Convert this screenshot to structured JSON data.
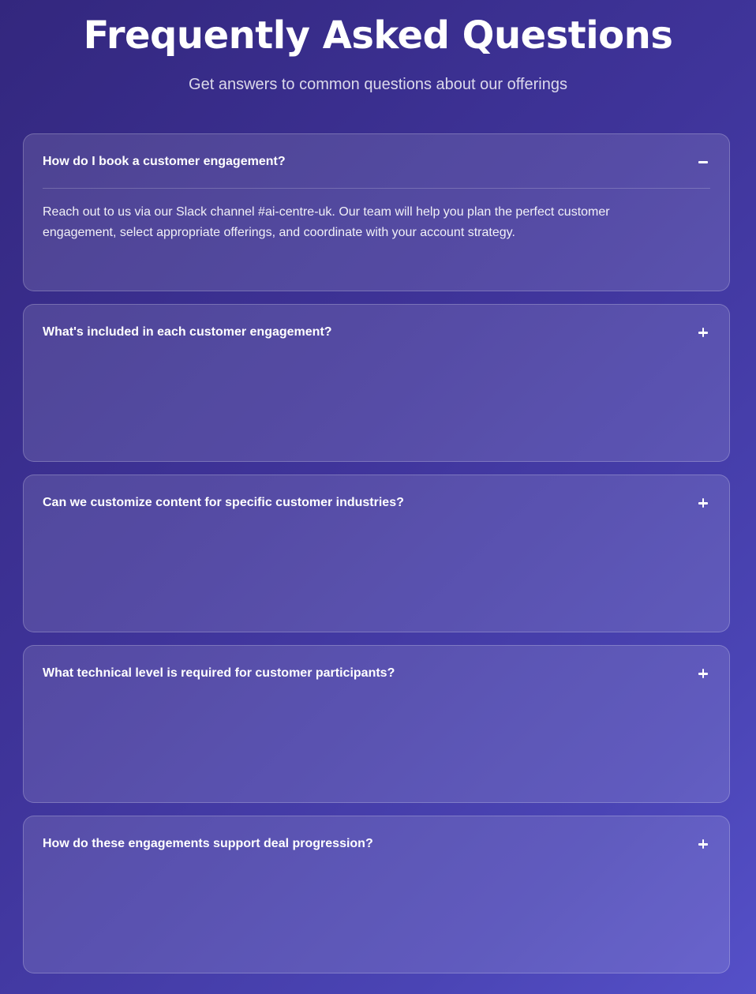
{
  "header": {
    "title": "Frequently Asked Questions",
    "subtitle": "Get answers to common questions about our offerings"
  },
  "faq": {
    "items": [
      {
        "question": "How do I book a customer engagement?",
        "expanded": true,
        "toggle_icon": "minus-icon",
        "answer": "Reach out to us via our Slack channel #ai-centre-uk. Our team will help you plan the perfect customer engagement, select appropriate offerings, and coordinate with your account strategy."
      },
      {
        "question": "What's included in each customer engagement?",
        "expanded": false,
        "toggle_icon": "plus-icon"
      },
      {
        "question": "Can we customize content for specific customer industries?",
        "expanded": false,
        "toggle_icon": "plus-icon"
      },
      {
        "question": "What technical level is required for customer participants?",
        "expanded": false,
        "toggle_icon": "plus-icon"
      },
      {
        "question": "How do these engagements support deal progression?",
        "expanded": false,
        "toggle_icon": "plus-icon"
      }
    ]
  }
}
